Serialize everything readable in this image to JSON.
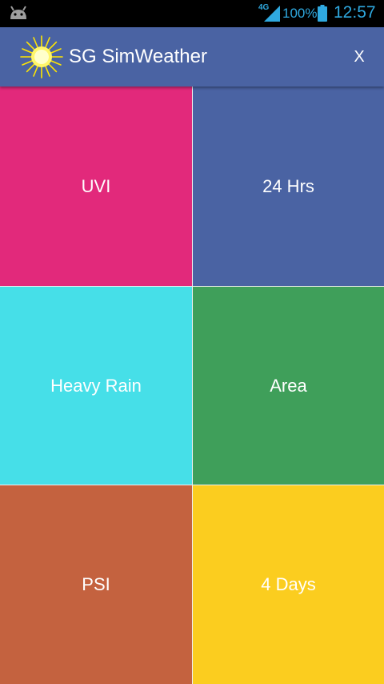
{
  "status_bar": {
    "network": "4G",
    "battery_percent": "100%",
    "time": "12:57",
    "icons": [
      "android-icon",
      "signal-icon",
      "battery-icon"
    ],
    "color": "#2fa9e0"
  },
  "app_bar": {
    "title": "SG SimWeather",
    "close_label": "X",
    "logo_icon": "sun-icon",
    "background": "#4a63a3"
  },
  "tiles": [
    {
      "label": "UVI",
      "color": "#e2297b"
    },
    {
      "label": "24 Hrs",
      "color": "#4a63a3"
    },
    {
      "label": "Heavy Rain",
      "color": "#46dfe8"
    },
    {
      "label": "Area",
      "color": "#3f9f5a"
    },
    {
      "label": "PSI",
      "color": "#c4623f"
    },
    {
      "label": "4 Days",
      "color": "#fbcd1f"
    }
  ]
}
